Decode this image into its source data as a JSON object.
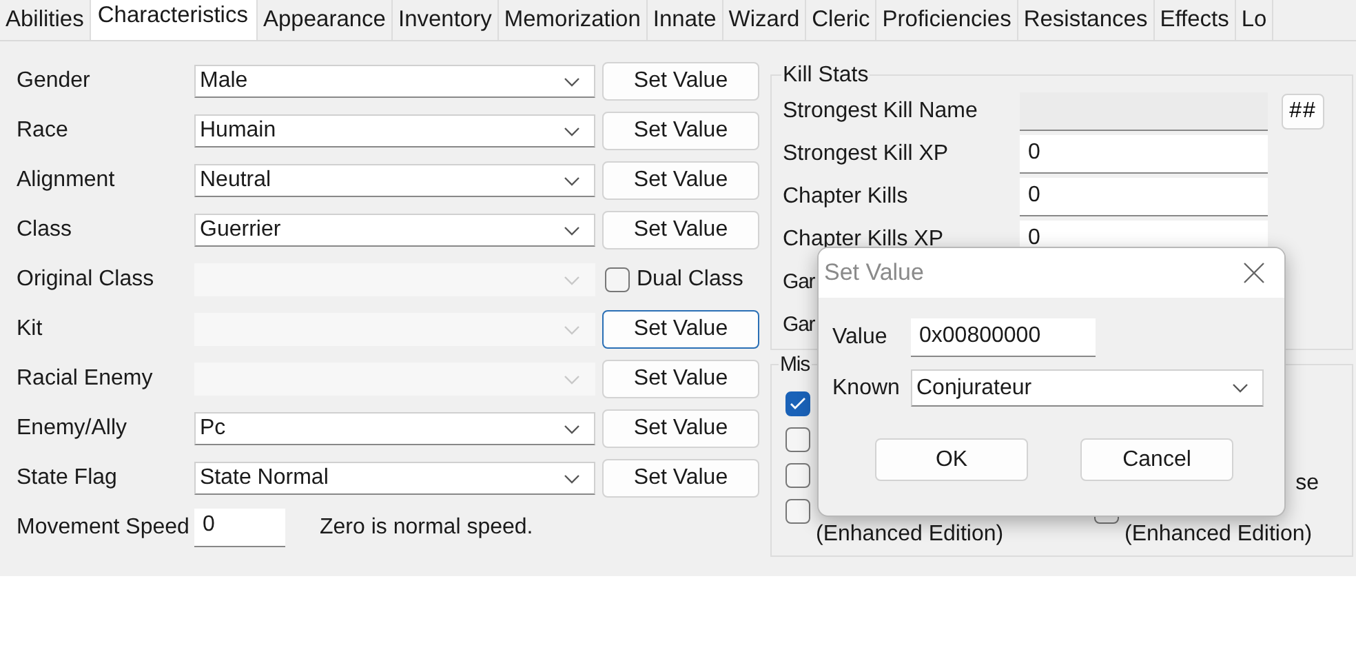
{
  "tabs": [
    {
      "label": "Abilities",
      "selected": false
    },
    {
      "label": "Characteristics",
      "selected": true
    },
    {
      "label": "Appearance",
      "selected": false
    },
    {
      "label": "Inventory",
      "selected": false
    },
    {
      "label": "Memorization",
      "selected": false
    },
    {
      "label": "Innate",
      "selected": false
    },
    {
      "label": "Wizard",
      "selected": false
    },
    {
      "label": "Cleric",
      "selected": false
    },
    {
      "label": "Proficiencies",
      "selected": false
    },
    {
      "label": "Resistances",
      "selected": false
    },
    {
      "label": "Effects",
      "selected": false
    },
    {
      "label": "Lo",
      "selected": false
    }
  ],
  "fields": [
    {
      "label": "Gender",
      "value": "Male",
      "disabled": false,
      "action": {
        "kind": "button",
        "label": "Set Value",
        "focused": false
      }
    },
    {
      "label": "Race",
      "value": "Humain",
      "disabled": false,
      "action": {
        "kind": "button",
        "label": "Set Value",
        "focused": false
      }
    },
    {
      "label": "Alignment",
      "value": "Neutral",
      "disabled": false,
      "action": {
        "kind": "button",
        "label": "Set Value",
        "focused": false
      }
    },
    {
      "label": "Class",
      "value": "Guerrier",
      "disabled": false,
      "action": {
        "kind": "button",
        "label": "Set Value",
        "focused": false
      }
    },
    {
      "label": "Original Class",
      "disabled": true,
      "action": {
        "kind": "checkbox",
        "label": "Dual Class",
        "checked": false
      }
    },
    {
      "label": "Kit",
      "disabled": true,
      "action": {
        "kind": "button",
        "label": "Set Value",
        "focused": true
      }
    },
    {
      "label": "Racial Enemy",
      "disabled": true,
      "action": {
        "kind": "button",
        "label": "Set Value",
        "focused": false
      }
    },
    {
      "label": "Enemy/Ally",
      "value": "Pc",
      "disabled": false,
      "action": {
        "kind": "button",
        "label": "Set Value",
        "focused": false
      }
    },
    {
      "label": "State Flag",
      "value": "State Normal",
      "disabled": false,
      "action": {
        "kind": "button",
        "label": "Set Value",
        "focused": false
      }
    }
  ],
  "movement_speed": {
    "label": "Movement Speed",
    "value": "0",
    "hint": "Zero is normal speed."
  },
  "kill_stats": {
    "title": "Kill Stats",
    "rows": [
      {
        "label": "Strongest Kill Name",
        "kind": "readonly",
        "button": "##"
      },
      {
        "label": "Strongest Kill XP",
        "kind": "input",
        "value": "0"
      },
      {
        "label": "Chapter Kills",
        "kind": "input",
        "value": "0"
      },
      {
        "label": "Chapter Kills XP",
        "kind": "input",
        "value": "0"
      },
      {
        "label": "Gar",
        "kind": "label"
      },
      {
        "label": "Gar",
        "kind": "label"
      }
    ]
  },
  "misc": {
    "title": "Mis",
    "rows": [
      {
        "left": {
          "checked": true
        }
      },
      {
        "left": {
          "checked": false
        }
      },
      {
        "left": {
          "checked": false
        },
        "right_text": "se"
      },
      {
        "left": {
          "checked": false,
          "label": "(Enhanced Edition)"
        },
        "right": {
          "checked": false,
          "label": "(Enhanced Edition)"
        }
      }
    ]
  },
  "dialog": {
    "title": "Set Value",
    "value_label": "Value",
    "value": "0x00800000",
    "known_label": "Known",
    "known": "Conjurateur",
    "buttons": [
      "OK",
      "Cancel"
    ]
  }
}
